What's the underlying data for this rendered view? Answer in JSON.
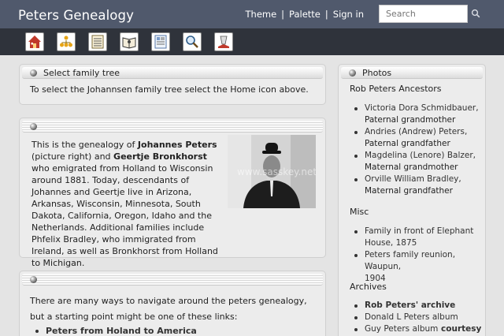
{
  "header": {
    "site_title": "Peters Genealogy",
    "nav": [
      {
        "label": "Theme"
      },
      {
        "label": "Palette"
      },
      {
        "label": "Sign in"
      }
    ],
    "nav_separator": "|",
    "search": {
      "placeholder": "Search",
      "icon": "search-icon"
    }
  },
  "toolbar": {
    "icons": [
      "home-icon",
      "family-tree-icon",
      "list-icon",
      "book-icon",
      "document-icon",
      "magnifier-icon",
      "bookmark-icon"
    ]
  },
  "panels": {
    "select_tree": {
      "title": "Select family tree",
      "text": "To select the Johannsen family tree select the Home icon above."
    },
    "intro": {
      "title": "",
      "text_parts": [
        "This is the genealogy of ",
        "Johannes Peters",
        " (picture right) and ",
        "Geertje Bronkhorst",
        " who emigrated from Holland to Wisconsin around 1881. Today, descendants of Johannes and Geertje live in Arizona, Arkansas, Wisconsin, Minnesota, South Dakota, California, Oregon, Idaho and the Netherlands.  Additional families include Phfelix Bradley, who immigrated from Ireland, as well as Bronkhorst from Holland to Michigan."
      ],
      "photo_watermark": "www.sasskey.net"
    },
    "navigate": {
      "title": "",
      "text": "There are many ways to navigate around the peters genealogy, but a starting point might be one of these links:",
      "links": [
        "Peters from Holand to America"
      ]
    }
  },
  "photos_panel": {
    "title": "Photos",
    "groups": [
      {
        "heading": "Rob Peters Ancestors",
        "items": [
          {
            "name": "Victoria Dora Schmidbauer,",
            "rel": "Paternal grandmother"
          },
          {
            "name": "Andries (Andrew) Peters,",
            "rel": "Paternal grandfather"
          },
          {
            "name": "Magdelina (Lenore) Balzer,",
            "rel": "Maternal grandmother"
          },
          {
            "name": "Orville William Bradley,",
            "rel": "Maternal grandfather"
          }
        ]
      },
      {
        "heading": "Misc",
        "items": [
          {
            "line1": "Family in front of Elephant",
            "line2": "House, 1875"
          },
          {
            "line1": "Peters family reunion, Waupun,",
            "line2": "1904"
          }
        ]
      },
      {
        "heading": "Archives",
        "items": [
          {
            "text": "Rob Peters' archive"
          },
          {
            "text": "Donald L Peters album"
          },
          {
            "text": "Guy Peters album",
            "suffix": " courtesy of"
          }
        ]
      }
    ]
  },
  "colors": {
    "header_bg": "#50596c",
    "toolbar_bg": "#2f333b",
    "page_bg": "#e4e4e4",
    "panel_bg": "#ececec"
  }
}
